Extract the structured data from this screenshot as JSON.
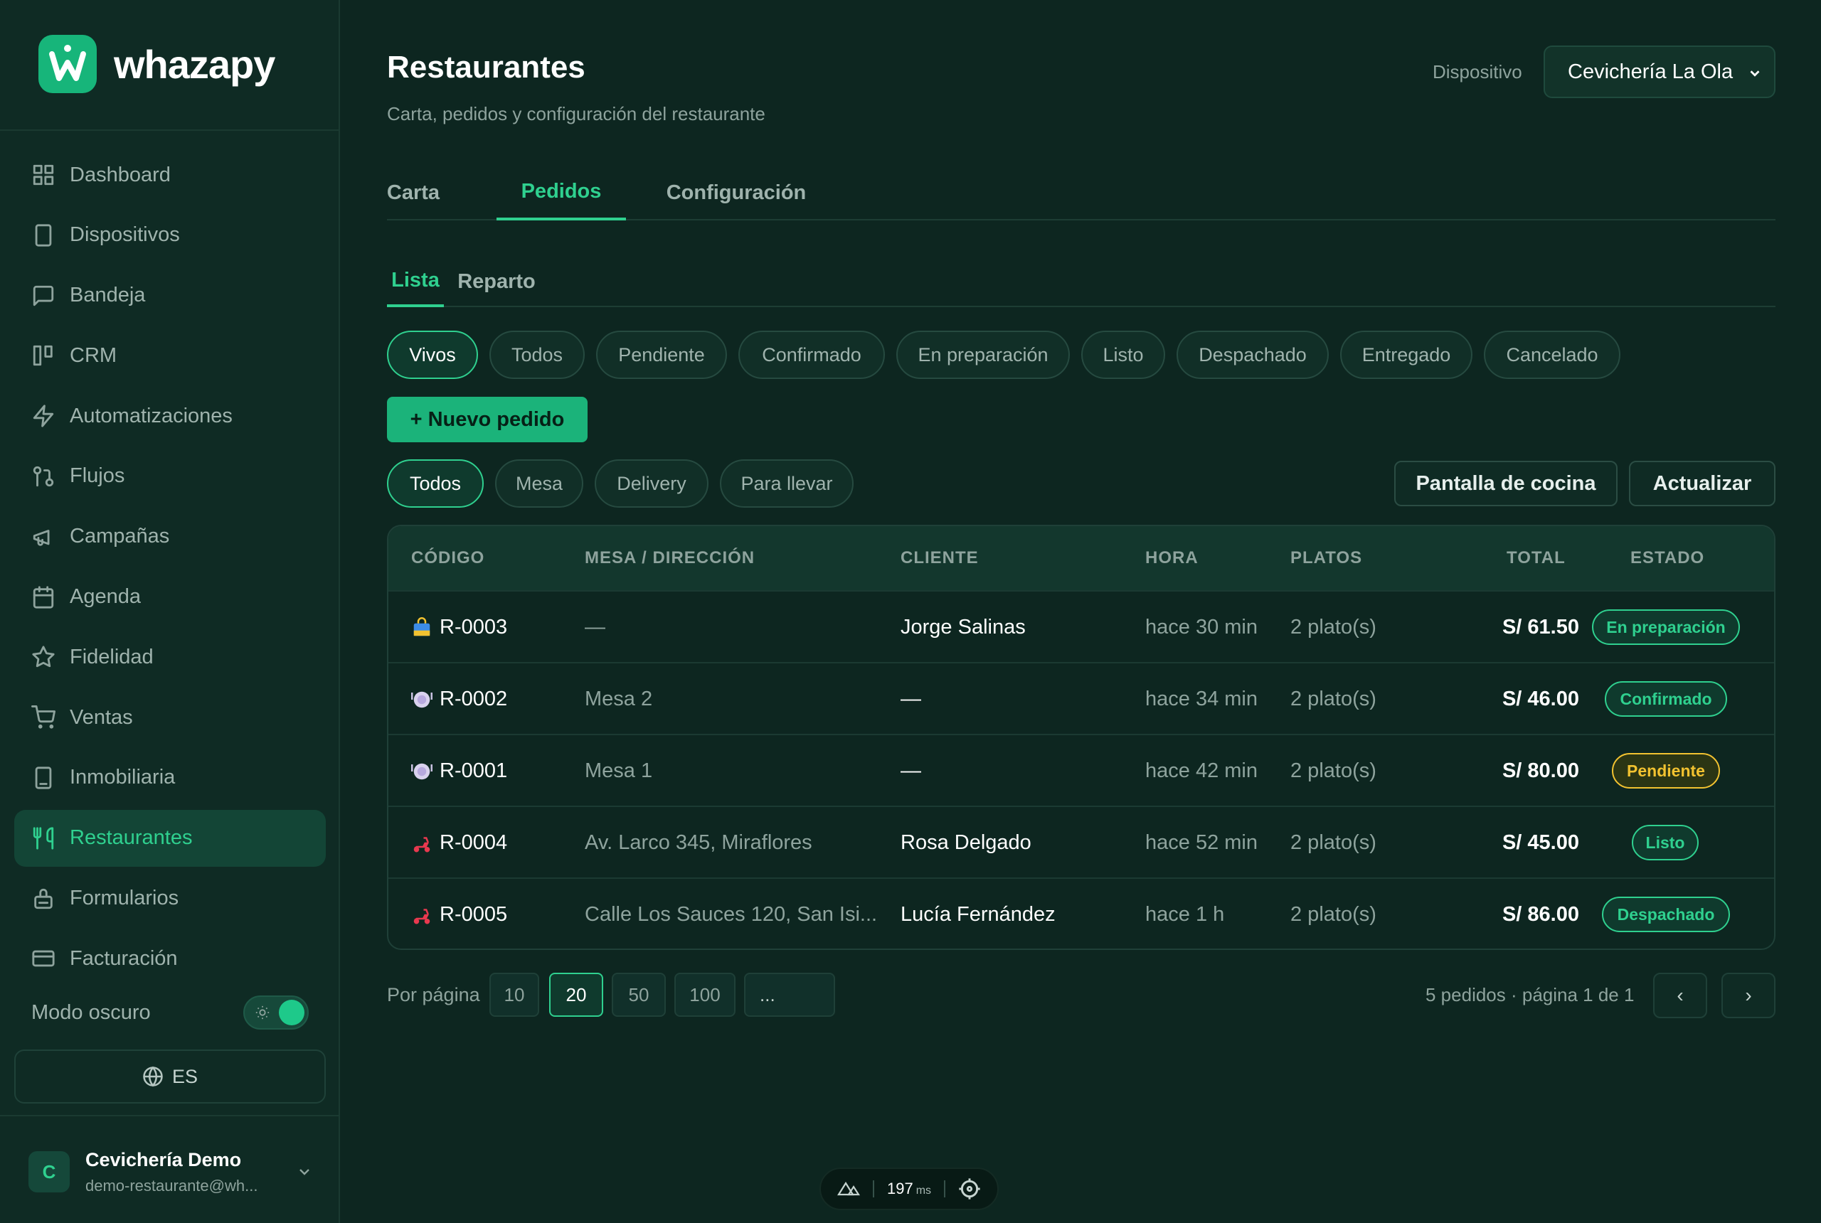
{
  "brand": {
    "name": "whazapy"
  },
  "sidebar": {
    "items": [
      {
        "label": "Dashboard",
        "icon": "grid-icon"
      },
      {
        "label": "Dispositivos",
        "icon": "smartphone-icon"
      },
      {
        "label": "Bandeja",
        "icon": "message-icon"
      },
      {
        "label": "CRM",
        "icon": "kanban-icon"
      },
      {
        "label": "Automatizaciones",
        "icon": "zap-icon"
      },
      {
        "label": "Flujos",
        "icon": "flow-icon"
      },
      {
        "label": "Campañas",
        "icon": "megaphone-icon"
      },
      {
        "label": "Agenda",
        "icon": "calendar-icon"
      },
      {
        "label": "Fidelidad",
        "icon": "star-icon"
      },
      {
        "label": "Ventas",
        "icon": "cart-icon"
      },
      {
        "label": "Inmobiliaria",
        "icon": "building-icon"
      },
      {
        "label": "Restaurantes",
        "icon": "utensils-icon",
        "active": true
      },
      {
        "label": "Formularios",
        "icon": "form-icon"
      },
      {
        "label": "Facturación",
        "icon": "credit-card-icon"
      }
    ],
    "dark_mode_label": "Modo oscuro",
    "language": "ES",
    "user": {
      "initial": "C",
      "name": "Cevichería Demo",
      "email": "demo-restaurante@wh..."
    }
  },
  "header": {
    "title": "Restaurantes",
    "subtitle": "Carta, pedidos y configuración del restaurante",
    "device_label": "Dispositivo",
    "device_value": "Cevichería La Ola"
  },
  "tabs": [
    "Carta",
    "Pedidos",
    "Configuración"
  ],
  "subtabs": [
    "Lista",
    "Reparto"
  ],
  "status_filters": [
    "Vivos",
    "Todos",
    "Pendiente",
    "Confirmado",
    "En preparación",
    "Listo",
    "Despachado",
    "Entregado",
    "Cancelado"
  ],
  "new_order_label": "+ Nuevo pedido",
  "type_filters": [
    "Todos",
    "Mesa",
    "Delivery",
    "Para llevar"
  ],
  "actions": {
    "kitchen_label": "Pantalla de cocina",
    "refresh_label": "Actualizar"
  },
  "table": {
    "headers": [
      "CÓDIGO",
      "MESA / DIRECCIÓN",
      "CLIENTE",
      "HORA",
      "PLATOS",
      "TOTAL",
      "ESTADO"
    ],
    "rows": [
      {
        "type_icon": "shopping-bag-icon",
        "code": "R-0003",
        "location": "—",
        "client": "Jorge Salinas",
        "time": "hace 30 min",
        "dishes": "2 plato(s)",
        "total": "S/ 61.50",
        "status": "En preparación",
        "status_color": "#2fd08f"
      },
      {
        "type_icon": "plate-icon",
        "code": "R-0002",
        "location": "Mesa 2",
        "client": "—",
        "time": "hace 34 min",
        "dishes": "2 plato(s)",
        "total": "S/ 46.00",
        "status": "Confirmado",
        "status_color": "#2fd08f"
      },
      {
        "type_icon": "plate-icon",
        "code": "R-0001",
        "location": "Mesa 1",
        "client": "—",
        "time": "hace 42 min",
        "dishes": "2 plato(s)",
        "total": "S/ 80.00",
        "status": "Pendiente",
        "status_color": "#f2c230"
      },
      {
        "type_icon": "scooter-icon",
        "code": "R-0004",
        "location": "Av. Larco 345, Miraflores",
        "client": "Rosa Delgado",
        "time": "hace 52 min",
        "dishes": "2 plato(s)",
        "total": "S/ 45.00",
        "status": "Listo",
        "status_color": "#2fd08f"
      },
      {
        "type_icon": "scooter-icon",
        "code": "R-0005",
        "location": "Calle Los Sauces 120, San Isi...",
        "client": "Lucía Fernández",
        "time": "hace 1 h",
        "dishes": "2 plato(s)",
        "total": "S/ 86.00",
        "status": "Despachado",
        "status_color": "#2fd08f"
      }
    ]
  },
  "pagination": {
    "per_page_label": "Por página",
    "options": [
      "10",
      "20",
      "50",
      "100",
      "..."
    ],
    "selected": "20",
    "info": "5 pedidos · página 1 de 1",
    "prev": "‹",
    "next": "›"
  },
  "perf": {
    "value": "197",
    "unit": "ms"
  },
  "colors": {
    "accent": "#2fd08f",
    "background": "#0d2620",
    "sidebar": "#0f2b24",
    "warning": "#f2c230"
  }
}
